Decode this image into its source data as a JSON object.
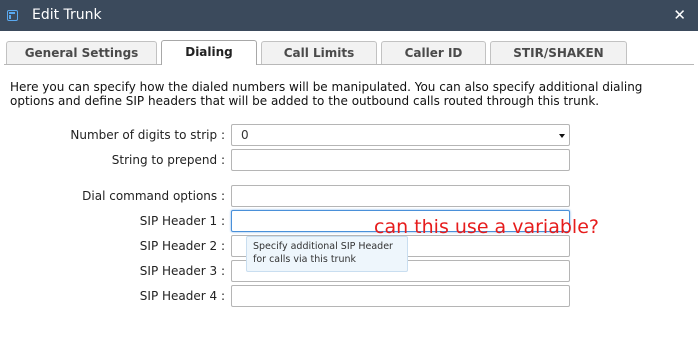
{
  "dialog": {
    "title": "Edit Trunk",
    "close_symbol": "✕"
  },
  "tabs": [
    {
      "label": "General Settings",
      "active": false
    },
    {
      "label": "Dialing",
      "active": true
    },
    {
      "label": "Call Limits",
      "active": false
    },
    {
      "label": "Caller ID",
      "active": false
    },
    {
      "label": "STIR/SHAKEN",
      "active": false
    }
  ],
  "intro_text": "Here you can specify how the dialed numbers will be manipulated. You can also specify additional dialing options and define SIP headers that will be added to the outbound calls routed through this trunk.",
  "form": {
    "digits_strip": {
      "label": "Number of digits to strip :",
      "value": "0"
    },
    "prepend": {
      "label": "String to prepend :",
      "value": ""
    },
    "dial_options": {
      "label": "Dial command options :",
      "value": ""
    },
    "sip_header_1": {
      "label": "SIP Header 1 :",
      "value": ""
    },
    "sip_header_2": {
      "label": "SIP Header 2 :",
      "value": ""
    },
    "sip_header_3": {
      "label": "SIP Header 3 :",
      "value": ""
    },
    "sip_header_4": {
      "label": "SIP Header 4 :",
      "value": ""
    }
  },
  "tooltip": {
    "text": "Specify additional SIP Header for calls via this trunk"
  },
  "annotation": {
    "text": "can this use a variable?",
    "color": "#e61c1c"
  },
  "colors": {
    "titlebar": "#3b4a5c",
    "focus_border": "#4a90d9"
  },
  "icons": {
    "window": "window-icon",
    "close": "close-icon",
    "dropdown": "chevron-down-icon"
  }
}
